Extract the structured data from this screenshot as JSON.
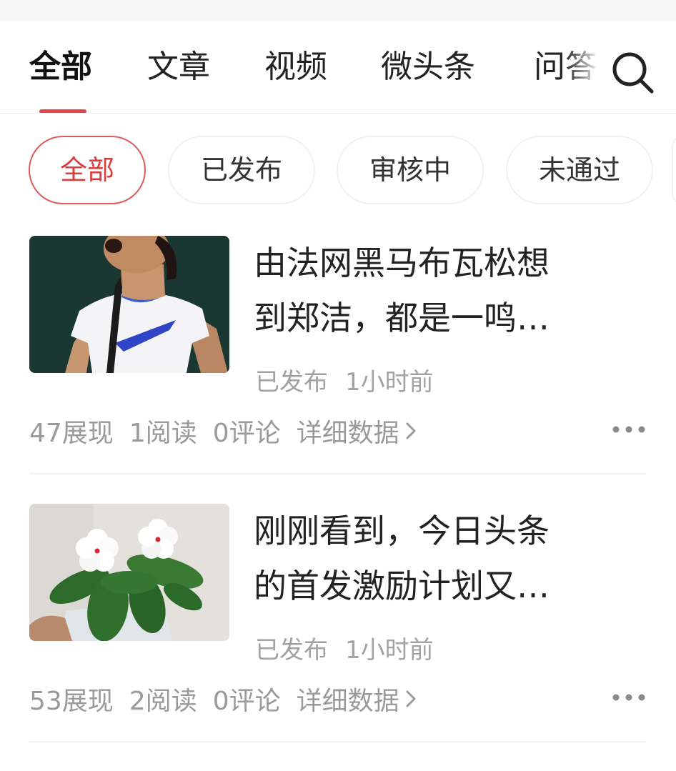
{
  "tabs": [
    {
      "label": "全部",
      "active": true
    },
    {
      "label": "文章"
    },
    {
      "label": "视频"
    },
    {
      "label": "微头条"
    },
    {
      "label": "问答"
    }
  ],
  "search_icon": "search-icon",
  "filters": [
    {
      "label": "全部",
      "active": true
    },
    {
      "label": "已发布"
    },
    {
      "label": "审核中"
    },
    {
      "label": "未通过"
    }
  ],
  "articles": [
    {
      "title_line1": "由法网黑马布瓦松想",
      "title_line2": "到郑洁，都是一鸣…",
      "status": "已发布",
      "time": "1小时前",
      "impressions": "47展现",
      "reads": "1阅读",
      "comments": "0评论",
      "detail_label": "详细数据"
    },
    {
      "title_line1": "刚刚看到，今日头条",
      "title_line2": "的首发激励计划又…",
      "status": "已发布",
      "time": "1小时前",
      "impressions": "53展现",
      "reads": "2阅读",
      "comments": "0评论",
      "detail_label": "详细数据"
    }
  ],
  "colors": {
    "accent": "#e2474a",
    "muted_text": "#9a9a9a"
  }
}
